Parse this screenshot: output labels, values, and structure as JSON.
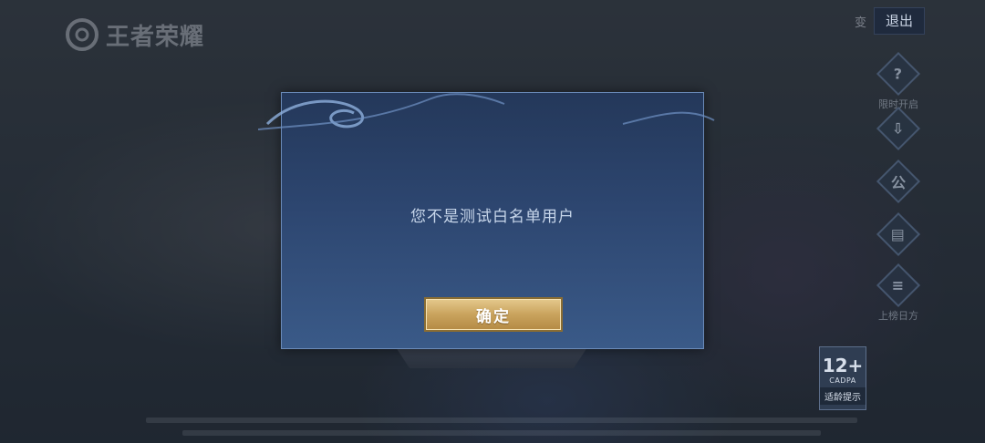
{
  "app": {
    "logo_text": "王者荣耀"
  },
  "header": {
    "side_small": "变",
    "exit_label": "退出"
  },
  "side_buttons": [
    {
      "icon": "question-icon",
      "glyph": "?",
      "label": "限时开启"
    },
    {
      "icon": "download-icon",
      "glyph": "⇩",
      "label": ""
    },
    {
      "icon": "announce-icon",
      "glyph": "公",
      "label": ""
    },
    {
      "icon": "card-icon",
      "glyph": "▤",
      "label": ""
    },
    {
      "icon": "notes-icon",
      "glyph": "≡",
      "label": "上榜日方"
    }
  ],
  "age_rating": {
    "age": "12+",
    "org": "CADPA",
    "hint": "适龄提示"
  },
  "dialog": {
    "message": "您不是测试白名单用户",
    "confirm_label": "确定"
  },
  "colors": {
    "dialog_bg": "#2d4670",
    "dialog_border": "#6a8ab8",
    "confirm_gold": "#c9a35d"
  }
}
